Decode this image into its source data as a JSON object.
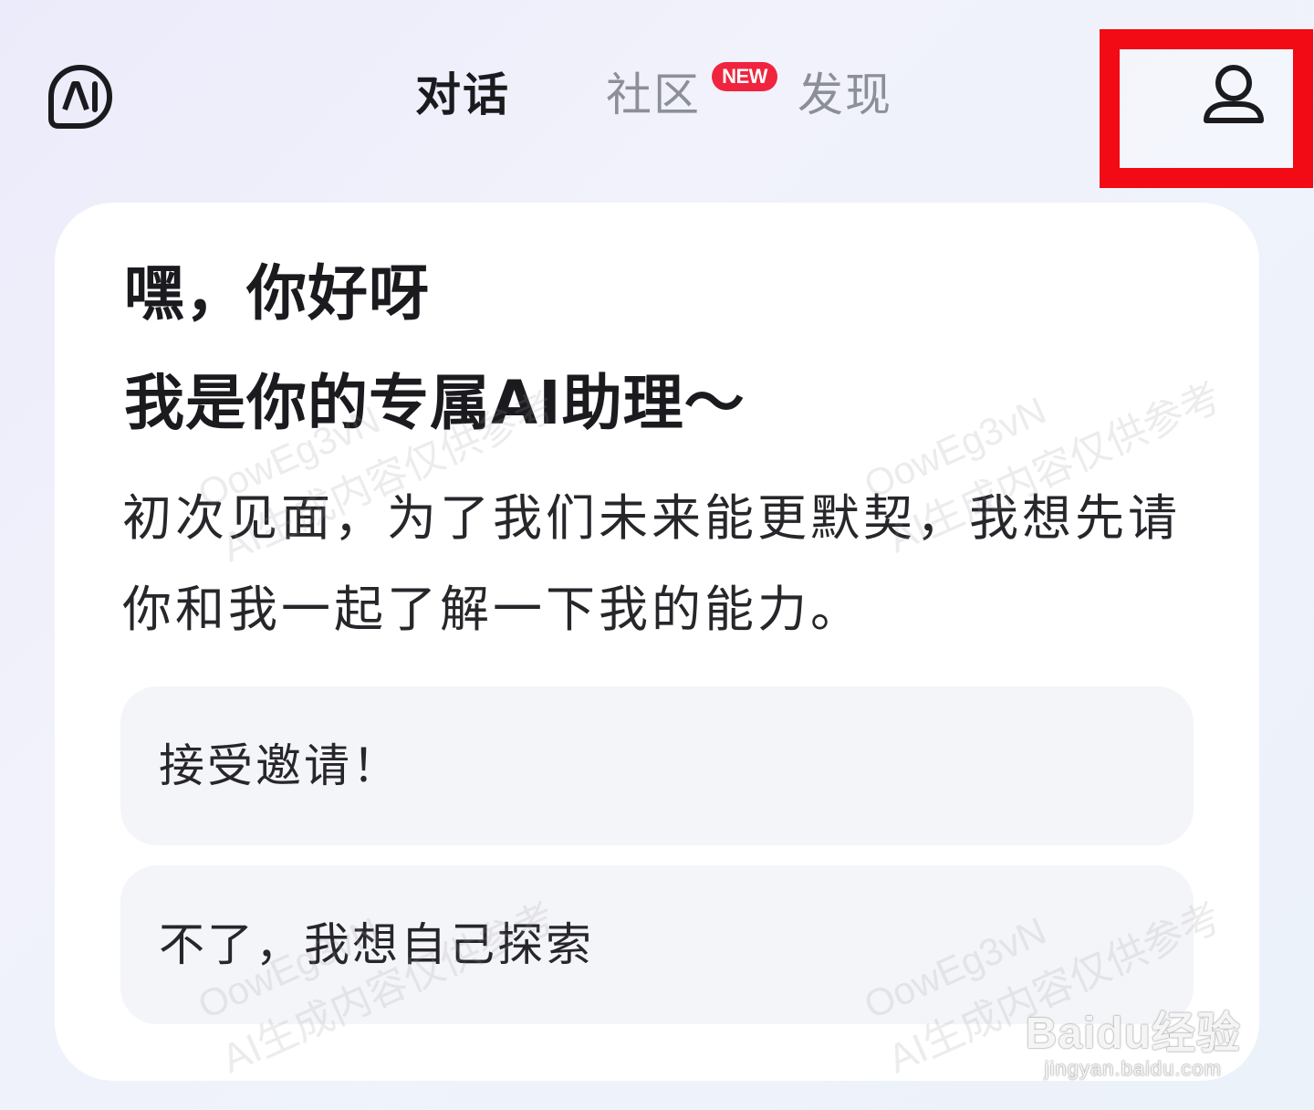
{
  "header": {
    "logo_icon": "ai-logo-icon",
    "tabs": [
      {
        "label": "对话",
        "active": true
      },
      {
        "label": "社区",
        "active": false,
        "badge": "NEW"
      },
      {
        "label": "发现",
        "active": false
      }
    ],
    "profile_icon": "user-icon",
    "highlight_color": "#f20a14"
  },
  "card": {
    "greeting": "嘿，你好呀",
    "subtitle": "我是你的专属AI助理～",
    "intro": "初次见面，为了我们未来能更默契，我想先请你和我一起了解一下我的能力。",
    "options": [
      {
        "label": "接受邀请！"
      },
      {
        "label": "不了，我想自己探索"
      }
    ]
  },
  "watermark": {
    "code": "OowEg3vN",
    "note": "AI生成内容仅供参考"
  },
  "baidu": {
    "brand": "Baidu经验",
    "url": "jingyan.baidu.com"
  }
}
